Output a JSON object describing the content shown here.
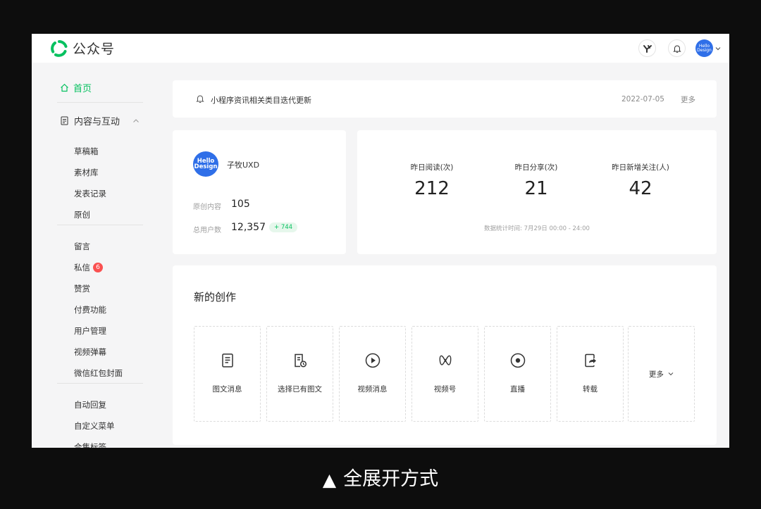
{
  "app": {
    "title": "公众号"
  },
  "sidebar": {
    "home": "首页",
    "section": "内容与互动",
    "group1": [
      "草稿箱",
      "素材库",
      "发表记录",
      "原创"
    ],
    "group2": [
      {
        "label": "留言"
      },
      {
        "label": "私信",
        "badge": "6"
      },
      {
        "label": "赞赏"
      },
      {
        "label": "付费功能"
      },
      {
        "label": "用户管理"
      },
      {
        "label": "视频弹幕"
      },
      {
        "label": "微信红包封面"
      }
    ],
    "group3": [
      "自动回复",
      "自定义菜单",
      "合集标签"
    ]
  },
  "header": {
    "avatar_line1": "Hello",
    "avatar_line2": "Design"
  },
  "notice": {
    "text": "小程序资讯相关类目迭代更新",
    "date": "2022-07-05",
    "more": "更多"
  },
  "profile": {
    "avatar_line1": "Hello",
    "avatar_line2": "Design",
    "name": "子牧UXD",
    "original_label": "原创内容",
    "original_value": "105",
    "users_label": "总用户数",
    "users_value": "12,357",
    "users_delta": "+ 744"
  },
  "stats": {
    "items": [
      {
        "label": "昨日阅读(次)",
        "value": "212"
      },
      {
        "label": "昨日分享(次)",
        "value": "21"
      },
      {
        "label": "昨日新增关注(人)",
        "value": "42"
      }
    ],
    "footnote": "数据统计时间: 7月29日 00:00 - 24:00"
  },
  "create": {
    "title": "新的创作",
    "tiles": [
      {
        "label": "图文消息",
        "icon": "document-icon"
      },
      {
        "label": "选择已有图文",
        "icon": "document-clock-icon"
      },
      {
        "label": "视频消息",
        "icon": "play-circle-icon"
      },
      {
        "label": "视频号",
        "icon": "channels-icon"
      },
      {
        "label": "直播",
        "icon": "live-icon"
      },
      {
        "label": "转载",
        "icon": "repost-icon"
      }
    ],
    "more": "更多"
  },
  "caption": {
    "symbol": "▲",
    "text": "全展开方式"
  },
  "colors": {
    "brand": "#07c160",
    "avatar": "#2f6fe8",
    "badge": "#fa5151"
  }
}
